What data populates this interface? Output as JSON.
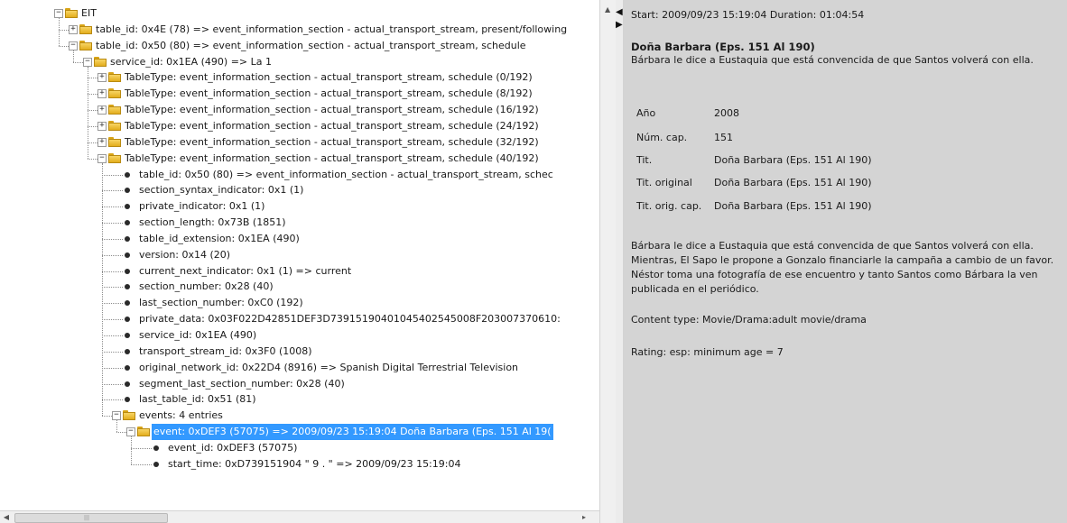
{
  "tree": {
    "rows": [
      {
        "depth": 0,
        "node": "folder",
        "expander": "minus",
        "label": "EIT"
      },
      {
        "depth": 1,
        "node": "folder",
        "expander": "plus",
        "label": "table_id: 0x4E (78) => event_information_section - actual_transport_stream, present/following"
      },
      {
        "depth": 1,
        "node": "folder",
        "expander": "minus",
        "label": "table_id: 0x50 (80) => event_information_section - actual_transport_stream, schedule"
      },
      {
        "depth": 2,
        "node": "folder",
        "expander": "minus",
        "label": "service_id: 0x1EA (490) => La 1"
      },
      {
        "depth": 3,
        "node": "folder",
        "expander": "plus",
        "label": "TableType: event_information_section - actual_transport_stream, schedule (0/192)"
      },
      {
        "depth": 3,
        "node": "folder",
        "expander": "plus",
        "label": "TableType: event_information_section - actual_transport_stream, schedule (8/192)"
      },
      {
        "depth": 3,
        "node": "folder",
        "expander": "plus",
        "label": "TableType: event_information_section - actual_transport_stream, schedule (16/192)"
      },
      {
        "depth": 3,
        "node": "folder",
        "expander": "plus",
        "label": "TableType: event_information_section - actual_transport_stream, schedule (24/192)"
      },
      {
        "depth": 3,
        "node": "folder",
        "expander": "plus",
        "label": "TableType: event_information_section - actual_transport_stream, schedule (32/192)"
      },
      {
        "depth": 3,
        "node": "folder",
        "expander": "minus",
        "label": "TableType: event_information_section - actual_transport_stream, schedule (40/192)"
      },
      {
        "depth": 4,
        "node": "leaf",
        "label": "table_id: 0x50 (80) => event_information_section - actual_transport_stream, schec"
      },
      {
        "depth": 4,
        "node": "leaf",
        "label": "section_syntax_indicator: 0x1 (1)"
      },
      {
        "depth": 4,
        "node": "leaf",
        "label": "private_indicator: 0x1 (1)"
      },
      {
        "depth": 4,
        "node": "leaf",
        "label": "section_length: 0x73B (1851)"
      },
      {
        "depth": 4,
        "node": "leaf",
        "label": "table_id_extension: 0x1EA (490)"
      },
      {
        "depth": 4,
        "node": "leaf",
        "label": "version: 0x14 (20)"
      },
      {
        "depth": 4,
        "node": "leaf",
        "label": "current_next_indicator: 0x1 (1) => current"
      },
      {
        "depth": 4,
        "node": "leaf",
        "label": "section_number: 0x28 (40)"
      },
      {
        "depth": 4,
        "node": "leaf",
        "label": "last_section_number: 0xC0 (192)"
      },
      {
        "depth": 4,
        "node": "leaf",
        "label": "private_data: 0x03F022D42851DEF3D73915190401045402545008F203007370610:"
      },
      {
        "depth": 4,
        "node": "leaf",
        "label": "service_id: 0x1EA (490)"
      },
      {
        "depth": 4,
        "node": "leaf",
        "label": "transport_stream_id: 0x3F0 (1008)"
      },
      {
        "depth": 4,
        "node": "leaf",
        "label": "original_network_id: 0x22D4 (8916) => Spanish Digital Terrestrial Television"
      },
      {
        "depth": 4,
        "node": "leaf",
        "label": "segment_last_section_number: 0x28 (40)"
      },
      {
        "depth": 4,
        "node": "leaf",
        "label": "last_table_id: 0x51 (81)"
      },
      {
        "depth": 4,
        "node": "folder",
        "expander": "minus",
        "label": "events: 4 entries"
      },
      {
        "depth": 5,
        "node": "folder",
        "expander": "minus",
        "selected": true,
        "label": "event: 0xDEF3 (57075) => 2009/09/23 15:19:04 Doña Barbara (Eps. 151 Al 19("
      },
      {
        "depth": 6,
        "node": "leaf",
        "label": "event_id: 0xDEF3 (57075)"
      },
      {
        "depth": 6,
        "node": "leaf",
        "label": "start_time: 0xD739151904 \" 9 . \" => 2009/09/23 15:19:04"
      }
    ]
  },
  "hscroll": {
    "grip": "|||"
  },
  "detail": {
    "start_line": "Start: 2009/09/23 15:19:04 Duration: 01:04:54",
    "title": "Doña Barbara (Eps. 151 Al 190)",
    "summary": "Bárbara le dice a Eustaquia que está convencida de que Santos volverá con ella.",
    "meta": [
      {
        "key": "Año",
        "value": "2008"
      },
      {
        "key": "Núm. cap.",
        "value": "151"
      },
      {
        "key": "Tit.",
        "value": "Doña Barbara (Eps. 151 Al 190)"
      },
      {
        "key": "Tit. original",
        "value": "Doña Barbara (Eps. 151 Al 190)"
      },
      {
        "key": "Tit. orig. cap.",
        "value": "Doña Barbara (Eps. 151 Al 190)"
      }
    ],
    "description": "Bárbara le dice a Eustaquia que está convencida de que Santos volverá con ella. Mientras, El Sapo le propone a Gonzalo financiarle la campaña a cambio de un favor. Néstor toma una fotografía de ese encuentro y tanto Santos como Bárbara la ven publicada en el periódico.",
    "content_type": "Content type: Movie/Drama:adult movie/drama",
    "rating": "Rating: esp: minimum age = 7"
  },
  "colors": {
    "selection": "#3399ff",
    "detail_background": "#d4d4d4",
    "folder": "#f0c53a"
  },
  "icons": {
    "folder": "folder-icon",
    "leaf": "bullet-icon",
    "expand": "plus-expander-icon",
    "collapse": "minus-expander-icon"
  }
}
